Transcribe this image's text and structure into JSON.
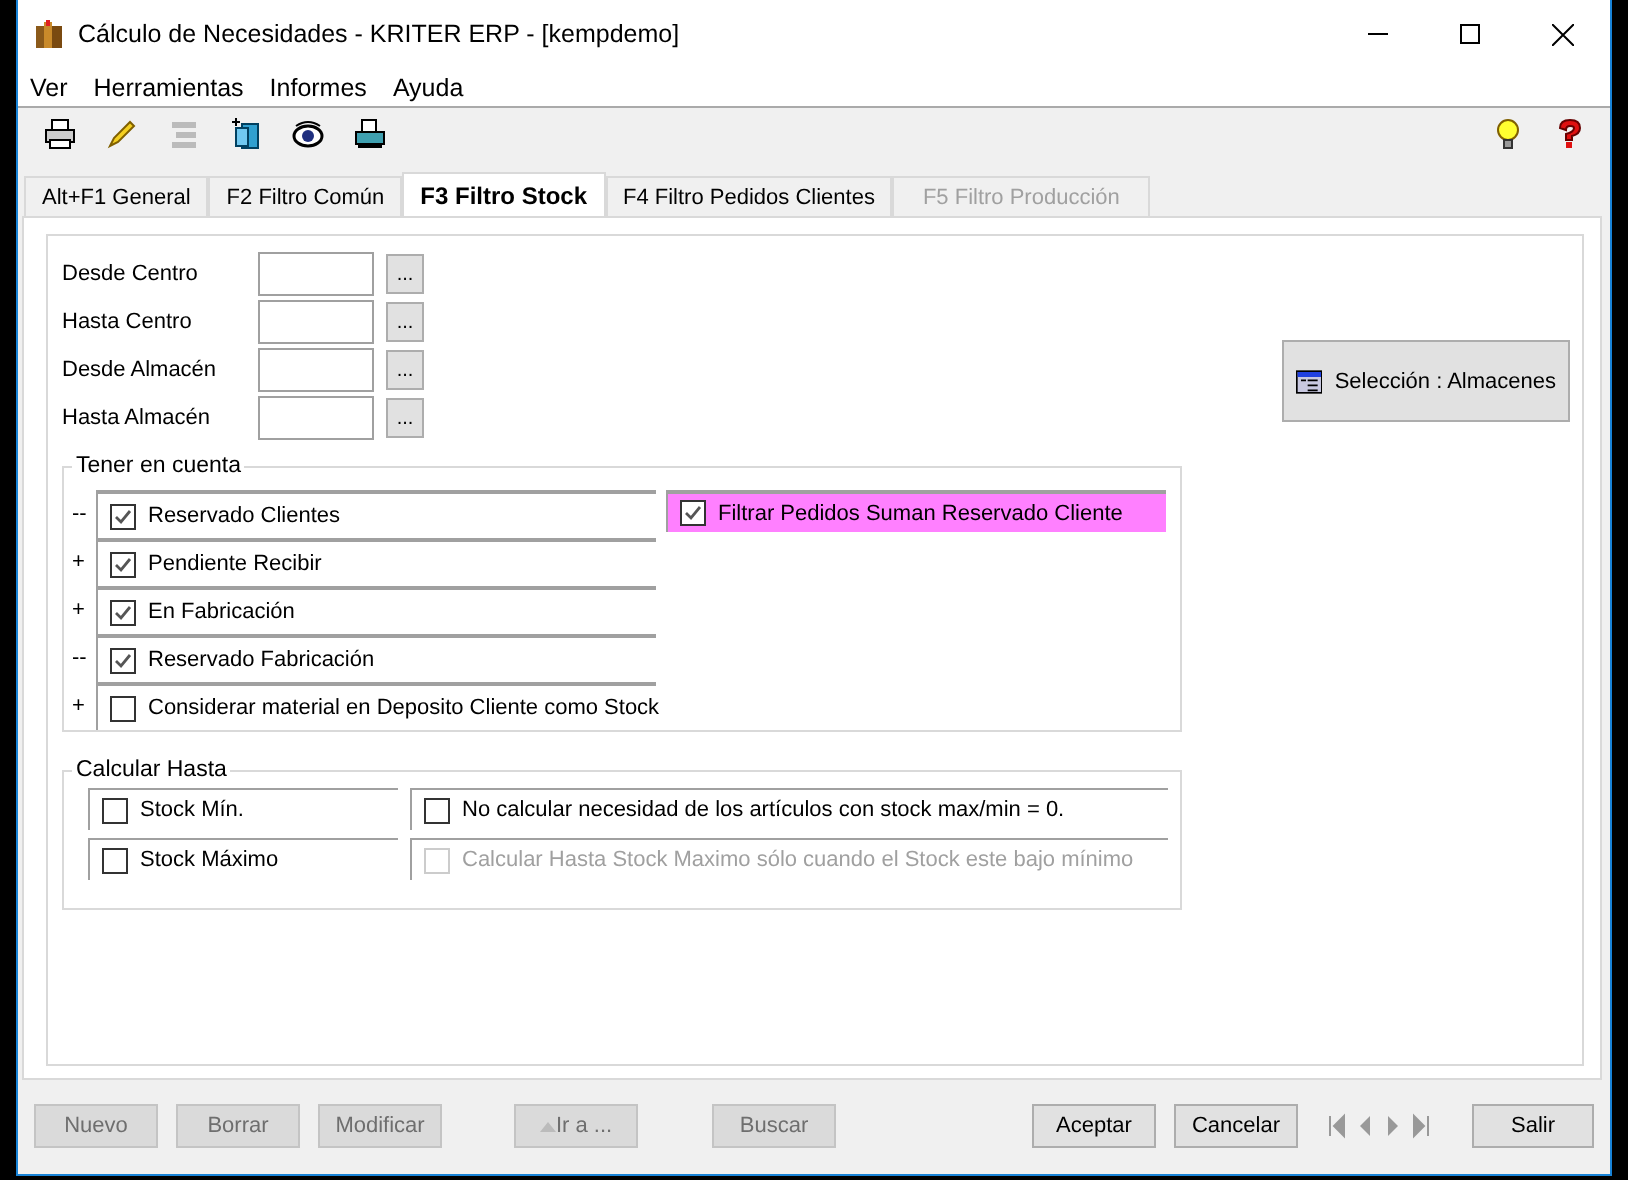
{
  "window": {
    "title": "Cálculo de Necesidades - KRITER ERP - [kempdemo]"
  },
  "menu": [
    "Ver",
    "Herramientas",
    "Informes",
    "Ayuda"
  ],
  "tabs": [
    {
      "label": "Alt+F1 General",
      "selected": false,
      "disabled": false
    },
    {
      "label": "F2 Filtro Común",
      "selected": false,
      "disabled": false
    },
    {
      "label": "F3 Filtro Stock",
      "selected": true,
      "disabled": false
    },
    {
      "label": "F4 Filtro Pedidos Clientes",
      "selected": false,
      "disabled": false
    },
    {
      "label": "F5 Filtro Producción",
      "selected": false,
      "disabled": true
    }
  ],
  "range_fields": [
    {
      "label": "Desde Centro",
      "button": "..."
    },
    {
      "label": "Hasta Centro",
      "button": "..."
    },
    {
      "label": "Desde Almacén",
      "button": "..."
    },
    {
      "label": "Hasta Almacén",
      "button": "..."
    }
  ],
  "selection_button": {
    "label": "Selección : Almacenes"
  },
  "consider_group": {
    "title": "Tener en cuenta",
    "rows": [
      {
        "sign": "--",
        "label": "Reservado Clientes",
        "checked": true
      },
      {
        "sign": "+",
        "label": "Pendiente Recibir",
        "checked": true
      },
      {
        "sign": "+",
        "label": "En Fabricación",
        "checked": true
      },
      {
        "sign": "--",
        "label": "Reservado Fabricación",
        "checked": true
      },
      {
        "sign": "+",
        "label": "Considerar material en Deposito Cliente como Stock",
        "checked": false
      }
    ],
    "side_option": {
      "label": "Filtrar Pedidos Suman Reservado Cliente",
      "checked": true,
      "color": "#ff80ff"
    }
  },
  "calc_group": {
    "title": "Calcular Hasta",
    "left": [
      {
        "label": "Stock Mín.",
        "checked": false,
        "disabled": false
      },
      {
        "label": "Stock Máximo",
        "checked": false,
        "disabled": false
      }
    ],
    "right": [
      {
        "label": "No calcular necesidad de los artículos con stock max/min = 0.",
        "checked": false,
        "disabled": false
      },
      {
        "label": "Calcular Hasta Stock Maximo sólo cuando el Stock este bajo mínimo",
        "checked": false,
        "disabled": true
      }
    ]
  },
  "buttons": [
    {
      "label": "Nuevo",
      "disabled": true
    },
    {
      "label": "Borrar",
      "disabled": true
    },
    {
      "label": "Modificar",
      "disabled": true
    },
    {
      "label": "Ir a ...",
      "disabled": true,
      "kind": "goto"
    },
    {
      "label": "Buscar",
      "disabled": true
    }
  ],
  "action_buttons": [
    {
      "label": "Aceptar",
      "disabled": false
    },
    {
      "label": "Cancelar",
      "disabled": false
    }
  ],
  "exit_button": {
    "label": "Salir",
    "disabled": false
  }
}
